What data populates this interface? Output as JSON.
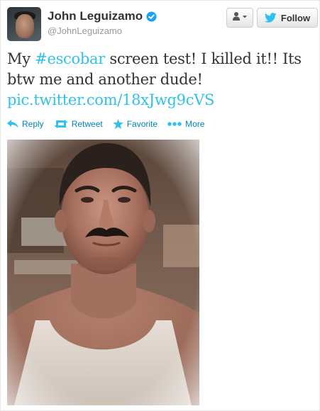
{
  "user": {
    "fullname": "John Leguizamo",
    "screen_name": "@JohnLeguizamo"
  },
  "header": {
    "follow_label": "Follow"
  },
  "tweet": {
    "text_pre": "My ",
    "hashtag": "#escobar",
    "text_post": " screen test! I killed it!! Its btw me and another dude!",
    "link": "pic.twitter.com/18xJwg9cVS"
  },
  "actions": {
    "reply": "Reply",
    "retweet": "Retweet",
    "favorite": "Favorite",
    "more": "More"
  },
  "colors": {
    "link": "#2fc2ef",
    "action": "#0084b4",
    "verified": "#1da1f2"
  },
  "icons": [
    "verified-badge-icon",
    "user-dropdown-icon",
    "twitter-bird-icon",
    "reply-icon",
    "retweet-icon",
    "favorite-star-icon",
    "more-dots-icon"
  ]
}
